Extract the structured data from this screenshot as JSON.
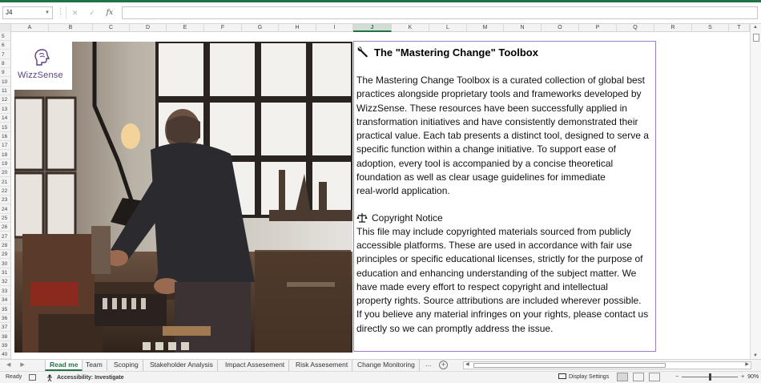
{
  "formula_bar": {
    "cell_ref": "J4",
    "fx_label": "fx",
    "formula_value": ""
  },
  "columns": {
    "labels": [
      "A",
      "B",
      "C",
      "D",
      "E",
      "F",
      "G",
      "H",
      "I",
      "J",
      "K",
      "L",
      "M",
      "N",
      "O",
      "P",
      "Q",
      "R",
      "S",
      "T"
    ],
    "selected": "J"
  },
  "rows": {
    "labels": [
      "5",
      "6",
      "7",
      "8",
      "9",
      "10",
      "11",
      "12",
      "13",
      "14",
      "15",
      "16",
      "17",
      "18",
      "19",
      "20",
      "21",
      "22",
      "23",
      "24",
      "25",
      "26",
      "27",
      "28",
      "29",
      "30",
      "31",
      "32",
      "33",
      "34",
      "35",
      "36",
      "37",
      "38",
      "39",
      "40"
    ]
  },
  "logo": {
    "text": "WizzSense",
    "brand_color": "#5a3f86"
  },
  "textbox": {
    "title": "The \"Mastering Change\" Toolbox",
    "title_icon": "wrench-icon",
    "intro": "The Mastering Change Toolbox is a curated collection of global best\npractices alongside proprietary tools and frameworks developed by\n WizzSense. These resources have been successfully applied in\ntransformation initiatives and have consistently demonstrated their\n practical value. Each tab presents a distinct tool, designed to serve a\n specific function within a change initiative. To support ease of\nadoption, every tool is accompanied by a concise theoretical\nfoundation as well as clear usage guidelines for immediate\nreal-world application.",
    "copyright_heading": "Copyright Notice",
    "copyright_icon": "scales-icon",
    "copyright_body": "This file may include copyrighted materials sourced from publicly\naccessible platforms. These are used in accordance with fair use\nprinciples or specific educational licenses, strictly for the purpose of\neducation and enhancing understanding of the subject matter. We\nhave made every effort to respect copyright and intellectual\nproperty rights. Source attributions are included wherever possible.\nIf you believe any material infringes on your rights, please contact us\ndirectly so we can promptly address the issue.",
    "border_color": "#a07ec0"
  },
  "sheet_tabs": {
    "items": [
      "Read me",
      "Team",
      "Scoping",
      "Stakeholder Analysis",
      "Impact Assesement",
      "Risk Assesement",
      "Change Monitoring"
    ],
    "active": "Read me",
    "more": "...",
    "add": "+"
  },
  "status_bar": {
    "ready": "Ready",
    "accessibility": "Accessibility: Investigate",
    "display_settings": "Display Settings",
    "zoom": "90%"
  },
  "accent_color": "#217346"
}
